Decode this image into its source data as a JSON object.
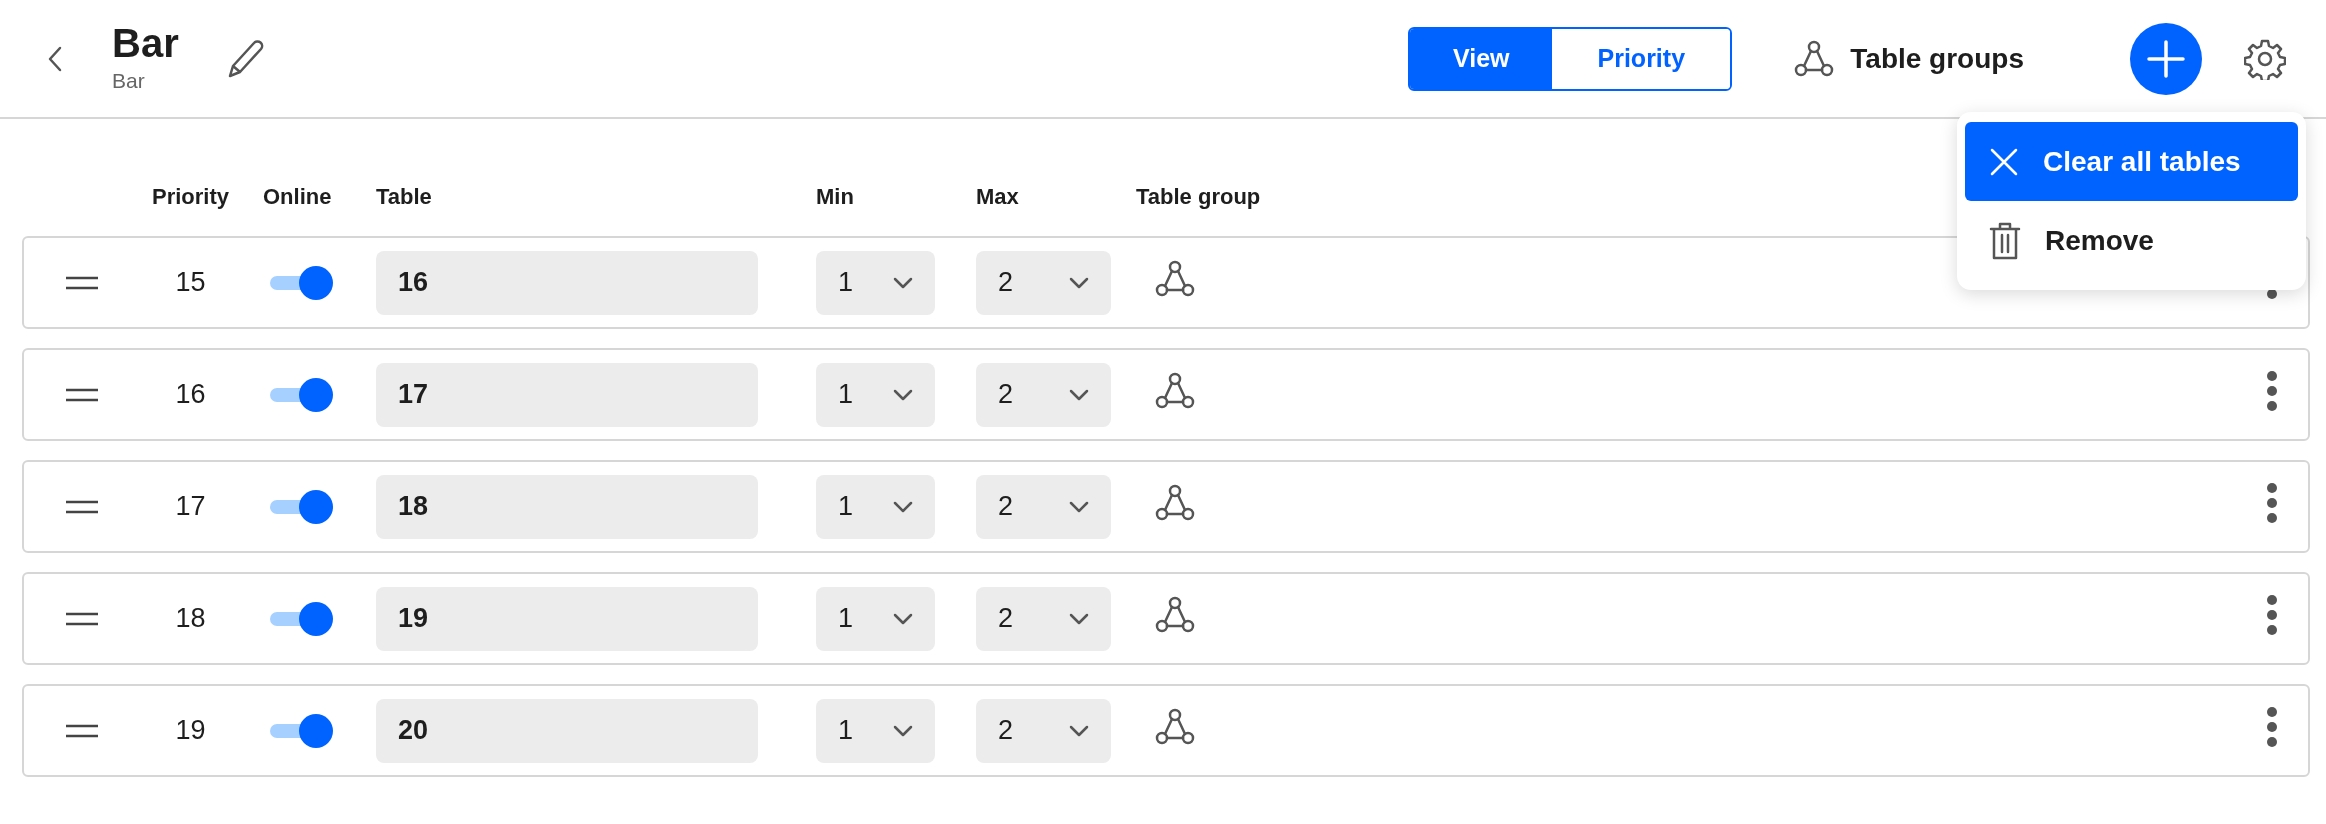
{
  "header": {
    "title": "Bar",
    "subtitle": "Bar"
  },
  "mode_toggle": [
    {
      "label": "View",
      "selected": true
    },
    {
      "label": "Priority",
      "selected": false
    }
  ],
  "table_groups_button": {
    "label": "Table groups"
  },
  "columns": [
    "Priority",
    "Online",
    "Table",
    "Min",
    "Max",
    "Table group"
  ],
  "rows": [
    {
      "priority": "15",
      "online": true,
      "table": "16",
      "min": "1",
      "max": "2"
    },
    {
      "priority": "16",
      "online": true,
      "table": "17",
      "min": "1",
      "max": "2"
    },
    {
      "priority": "17",
      "online": true,
      "table": "18",
      "min": "1",
      "max": "2"
    },
    {
      "priority": "18",
      "online": true,
      "table": "19",
      "min": "1",
      "max": "2"
    },
    {
      "priority": "19",
      "online": true,
      "table": "20",
      "min": "1",
      "max": "2"
    }
  ],
  "menu": [
    {
      "label": "Clear all tables",
      "kind": "clear",
      "selected": true
    },
    {
      "label": "Remove",
      "kind": "remove",
      "selected": false
    }
  ]
}
